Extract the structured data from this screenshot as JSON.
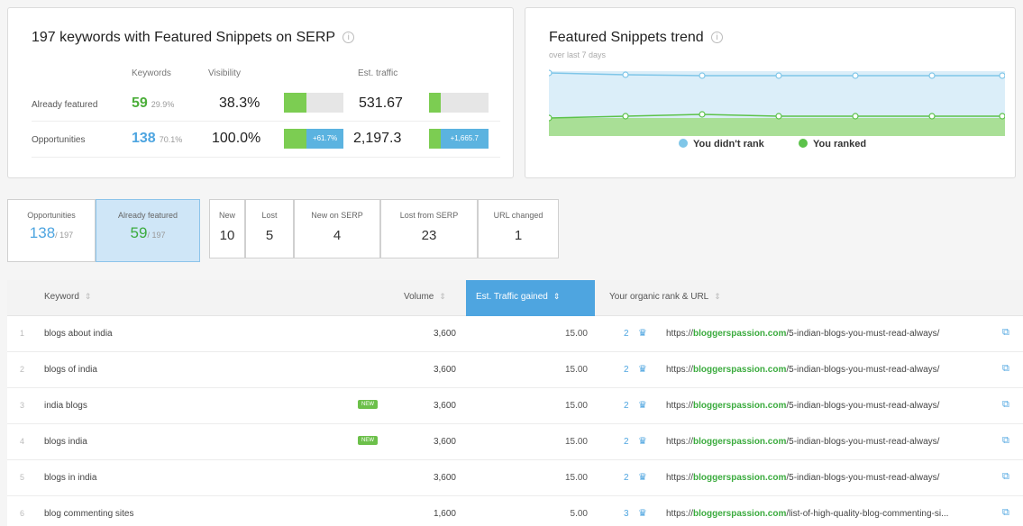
{
  "summary": {
    "title": "197 keywords with Featured Snippets on SERP",
    "col_keywords": "Keywords",
    "col_visibility": "Visibility",
    "col_traffic": "Est. traffic",
    "rows": [
      {
        "label": "Already featured",
        "keywords": "59",
        "pct": "29.9%",
        "visibility": "38.3%",
        "traffic": "531.67",
        "vis_fill": 0.383,
        "traf_fill": 0.19,
        "vis_badge": "",
        "traf_badge": ""
      },
      {
        "label": "Opportunities",
        "keywords": "138",
        "pct": "70.1%",
        "visibility": "100.0%",
        "traffic": "2,197.3",
        "vis_fill": 0.383,
        "traf_fill": 0.19,
        "vis_badge": "+61.7%",
        "traf_badge": "+1,665.7"
      }
    ]
  },
  "trend": {
    "title": "Featured Snippets trend",
    "subtitle": "over last 7 days",
    "legend_didnt_rank": "You didn't rank",
    "legend_ranked": "You ranked",
    "color_didnt_rank": "#7fc6e8",
    "color_ranked": "#5cc24a"
  },
  "filters": {
    "opportunities": {
      "label": "Opportunities",
      "value": "138",
      "total": "/ 197"
    },
    "already_featured": {
      "label": "Already featured",
      "value": "59",
      "total": "/ 197"
    },
    "new": {
      "label": "New",
      "value": "10"
    },
    "lost": {
      "label": "Lost",
      "value": "5"
    },
    "new_on_serp": {
      "label": "New on SERP",
      "value": "4"
    },
    "lost_from_serp": {
      "label": "Lost from SERP",
      "value": "23"
    },
    "url_changed": {
      "label": "URL changed",
      "value": "1"
    }
  },
  "table": {
    "headers": {
      "keyword": "Keyword",
      "volume": "Volume",
      "traffic": "Est. Traffic gained",
      "rank_url": "Your organic rank & URL"
    },
    "new_badge": "NEW",
    "rows": [
      {
        "index": "1",
        "keyword": "blogs about india",
        "is_new": false,
        "volume": "3,600",
        "traffic": "15.00",
        "rank": "2",
        "url_prefix": "https://",
        "url_domain": "bloggerspassion.com",
        "url_path": "/5-indian-blogs-you-must-read-always/"
      },
      {
        "index": "2",
        "keyword": "blogs of india",
        "is_new": false,
        "volume": "3,600",
        "traffic": "15.00",
        "rank": "2",
        "url_prefix": "https://",
        "url_domain": "bloggerspassion.com",
        "url_path": "/5-indian-blogs-you-must-read-always/"
      },
      {
        "index": "3",
        "keyword": "india blogs",
        "is_new": true,
        "volume": "3,600",
        "traffic": "15.00",
        "rank": "2",
        "url_prefix": "https://",
        "url_domain": "bloggerspassion.com",
        "url_path": "/5-indian-blogs-you-must-read-always/"
      },
      {
        "index": "4",
        "keyword": "blogs india",
        "is_new": true,
        "volume": "3,600",
        "traffic": "15.00",
        "rank": "2",
        "url_prefix": "https://",
        "url_domain": "bloggerspassion.com",
        "url_path": "/5-indian-blogs-you-must-read-always/"
      },
      {
        "index": "5",
        "keyword": "blogs in india",
        "is_new": false,
        "volume": "3,600",
        "traffic": "15.00",
        "rank": "2",
        "url_prefix": "https://",
        "url_domain": "bloggerspassion.com",
        "url_path": "/5-indian-blogs-you-must-read-always/"
      },
      {
        "index": "6",
        "keyword": "blog commenting sites",
        "is_new": false,
        "volume": "1,600",
        "traffic": "5.00",
        "rank": "3",
        "url_prefix": "https://",
        "url_domain": "bloggerspassion.com",
        "url_path": "/list-of-high-quality-blog-commenting-si..."
      }
    ]
  }
}
